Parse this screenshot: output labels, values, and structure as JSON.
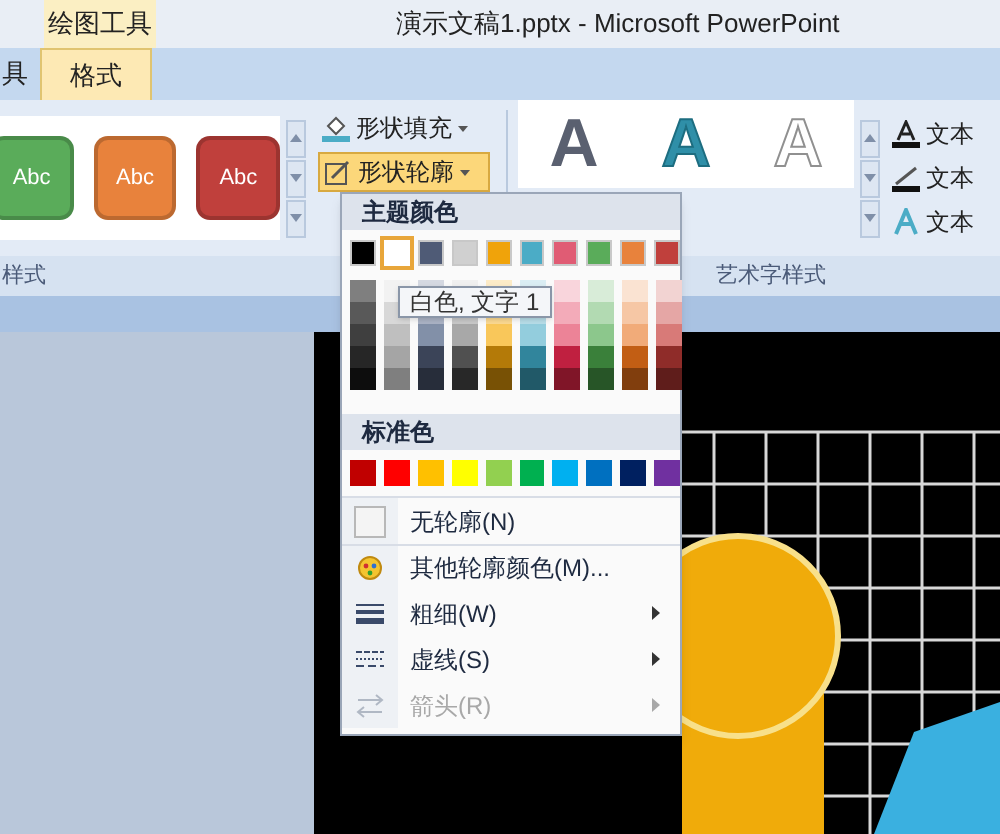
{
  "window": {
    "title": "演示文稿1.pptx - Microsoft PowerPoint",
    "context_tab": "绘图工具"
  },
  "tabs": [
    {
      "label": "具",
      "selected": false
    },
    {
      "label": "格式",
      "selected": true
    }
  ],
  "shape_styles": [
    {
      "label": "Abc",
      "color": "#5aac5a"
    },
    {
      "label": "Abc",
      "color": "#e8823c"
    },
    {
      "label": "Abc",
      "color": "#c0403c"
    }
  ],
  "shape_buttons": [
    {
      "label": "形状填充",
      "kind": "fill",
      "open": false
    },
    {
      "label": "形状轮廓",
      "kind": "outline",
      "open": true
    }
  ],
  "wordart_styles": [
    {
      "label": "A",
      "kind": "gray"
    },
    {
      "label": "A",
      "kind": "teal"
    },
    {
      "label": "A",
      "kind": "white"
    }
  ],
  "text_buttons": [
    {
      "label": "文本",
      "kind": "fill"
    },
    {
      "label": "文本",
      "kind": "outline"
    },
    {
      "label": "文本",
      "kind": "effects"
    }
  ],
  "group_labels": [
    {
      "label": "样式"
    },
    {
      "label": "艺术字样式"
    }
  ],
  "menu": {
    "theme_header": "主题颜色",
    "theme_colors": [
      {
        "color": "#000000",
        "selected": false,
        "shades": [
          {
            "color": "#7f7f7f"
          },
          {
            "color": "#595959"
          },
          {
            "color": "#3f3f3f"
          },
          {
            "color": "#262626"
          },
          {
            "color": "#0d0d0d"
          }
        ]
      },
      {
        "color": "#ffffff",
        "selected": true,
        "shades": [
          {
            "color": "#f2f2f2"
          },
          {
            "color": "#d8d8d8"
          },
          {
            "color": "#bfbfbf"
          },
          {
            "color": "#a5a5a5"
          },
          {
            "color": "#7f7f7f"
          }
        ]
      },
      {
        "color": "#4f5b76",
        "selected": false,
        "shades": [
          {
            "color": "#d5d9e2"
          },
          {
            "color": "#abb3c5"
          },
          {
            "color": "#8290a8"
          },
          {
            "color": "#3b4458"
          },
          {
            "color": "#272d3a"
          }
        ]
      },
      {
        "color": "#d0d0d0",
        "selected": false,
        "shades": [
          {
            "color": "#f0f0f0"
          },
          {
            "color": "#c8c8c8"
          },
          {
            "color": "#a8a8a8"
          },
          {
            "color": "#505050"
          },
          {
            "color": "#282828"
          }
        ]
      },
      {
        "color": "#f0a30a",
        "selected": false,
        "shades": [
          {
            "color": "#fdecc8"
          },
          {
            "color": "#fbd991"
          },
          {
            "color": "#f9c75a"
          },
          {
            "color": "#b47a08"
          },
          {
            "color": "#785105"
          }
        ]
      },
      {
        "color": "#4bacc6",
        "selected": false,
        "shades": [
          {
            "color": "#dbeef4"
          },
          {
            "color": "#b7dde8"
          },
          {
            "color": "#93cddd"
          },
          {
            "color": "#31859c"
          },
          {
            "color": "#215968"
          }
        ]
      },
      {
        "color": "#e05c74",
        "selected": false,
        "shades": [
          {
            "color": "#f9d5dc"
          },
          {
            "color": "#f3abb9"
          },
          {
            "color": "#ec8397"
          },
          {
            "color": "#c02040"
          },
          {
            "color": "#801528"
          }
        ]
      },
      {
        "color": "#5aac5a",
        "selected": false,
        "shades": [
          {
            "color": "#d8ecd8"
          },
          {
            "color": "#b2dab2"
          },
          {
            "color": "#8cc78c"
          },
          {
            "color": "#3a803a"
          },
          {
            "color": "#275527"
          }
        ]
      },
      {
        "color": "#e8823c",
        "selected": false,
        "shades": [
          {
            "color": "#fae3d2"
          },
          {
            "color": "#f6c7a5"
          },
          {
            "color": "#f1ab79"
          },
          {
            "color": "#c25e14"
          },
          {
            "color": "#813e0d"
          }
        ]
      },
      {
        "color": "#c0403c",
        "selected": false,
        "shades": [
          {
            "color": "#f2d3d2"
          },
          {
            "color": "#e5a6a5"
          },
          {
            "color": "#d87a78"
          },
          {
            "color": "#8f2c29"
          },
          {
            "color": "#5f1d1b"
          }
        ]
      }
    ],
    "tooltip": "白色, 文字 1",
    "standard_header": "标准色",
    "standard_colors": [
      {
        "color": "#c00000"
      },
      {
        "color": "#ff0000"
      },
      {
        "color": "#ffc000"
      },
      {
        "color": "#ffff00"
      },
      {
        "color": "#92d050"
      },
      {
        "color": "#00b050"
      },
      {
        "color": "#00b0f0"
      },
      {
        "color": "#0070c0"
      },
      {
        "color": "#002060"
      },
      {
        "color": "#7030a0"
      }
    ],
    "items": [
      {
        "label": "无轮廓(N)",
        "kind": "none",
        "disabled": false,
        "submenu": false
      },
      {
        "label": "其他轮廓颜色(M)...",
        "kind": "more",
        "disabled": false,
        "submenu": false
      },
      {
        "label": "粗细(W)",
        "kind": "weight",
        "disabled": false,
        "submenu": true
      },
      {
        "label": "虚线(S)",
        "kind": "dash",
        "disabled": false,
        "submenu": true
      },
      {
        "label": "箭头(R)",
        "kind": "arrow",
        "disabled": true,
        "submenu": true
      }
    ]
  }
}
